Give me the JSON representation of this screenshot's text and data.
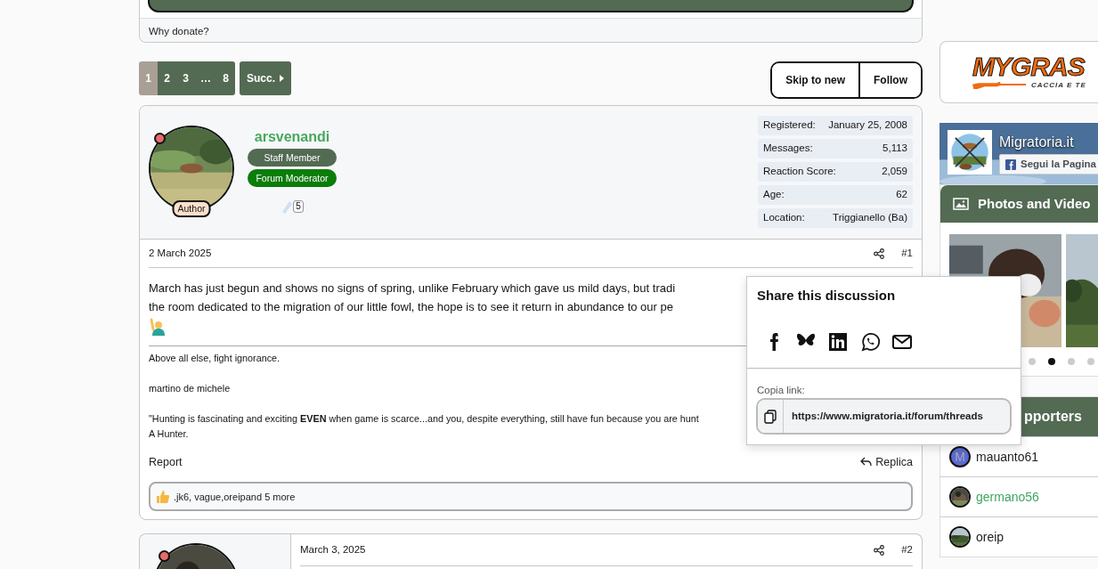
{
  "donate": {
    "footer_link": "Why donate?"
  },
  "pagination": {
    "pages": [
      {
        "label": "1",
        "selected": true
      },
      {
        "label": "2",
        "selected": false
      },
      {
        "label": "3",
        "selected": false
      },
      {
        "label": "…",
        "selected": false
      },
      {
        "label": "8",
        "selected": false
      }
    ],
    "next": "Succ."
  },
  "thread_actions": [
    "Skip to new",
    "Follow"
  ],
  "posts": [
    {
      "kind": "full",
      "author": {
        "name": "arsvenandi",
        "badge": "Author",
        "status_dot": {
          "color": "#e86a6a"
        },
        "titles": [
          {
            "label": "Staff Member",
            "color": "#536a53"
          },
          {
            "label": "Forum Moderator",
            "color": "#0a7d0a"
          }
        ],
        "rank": "5",
        "stats": [
          {
            "label": "Registered:",
            "value": "January 25, 2008"
          },
          {
            "label": "Messages:",
            "value": "5,113"
          },
          {
            "label": "Reaction Score:",
            "value": "2,059"
          },
          {
            "label": "Age:",
            "value": "62"
          },
          {
            "label": "Location:",
            "value": "Triggianello (Ba)"
          }
        ]
      },
      "date": "2 March 2025",
      "number": "#1",
      "body_lines": [
        "March has just begun and shows no signs of spring, unlike February which gave us mild days, but tradi",
        "the room dedicated to the migration of our little fowl, the hope is to see it return in abundance to our pe"
      ],
      "signature": [
        [
          "Above all else, fight ignorance."
        ],
        [
          "martino de michele"
        ],
        [
          "\"Hunting is fascinating and exciting **EVEN** when game is scarce...and you, despite everything, still have fun because you are hunt",
          "A Hunter."
        ]
      ],
      "report": "Report",
      "reply": "Replica",
      "reactions": ".jk6, vague,oreipand 5 more"
    },
    {
      "kind": "compact",
      "author": {
        "status_dot": {
          "color": "#e86a6a"
        }
      },
      "date": "March 3, 2025",
      "number": "#2"
    }
  ],
  "share_popup": {
    "title": "Share this discussion",
    "buttons": [
      {
        "kind": "facebook"
      },
      {
        "kind": "bluesky"
      },
      {
        "kind": "linkedin"
      },
      {
        "kind": "whatsapp"
      },
      {
        "kind": "email"
      }
    ],
    "copy_label": "Copia link:",
    "url": "https://www.migratoria.it/forum/threads"
  },
  "sidebar": {
    "logo": {
      "text": "MYGRAS",
      "tagline": "CACCIA E TE"
    },
    "facebook": {
      "page_name": "Migratoria.it",
      "follow": "Segui la Pagina"
    },
    "media": {
      "title": "Photos and Video",
      "dots": [
        {
          "selected": false
        },
        {
          "selected": true
        },
        {
          "selected": false
        },
        {
          "selected": false
        }
      ]
    },
    "supporters": {
      "title": "pporters",
      "members": [
        {
          "name": "mauanto61",
          "kind": "letter",
          "initial": "M",
          "color": "#222222"
        },
        {
          "name": "germano56",
          "color": "#3fa55f"
        },
        {
          "name": "oreip",
          "color": "#222222"
        }
      ]
    }
  }
}
